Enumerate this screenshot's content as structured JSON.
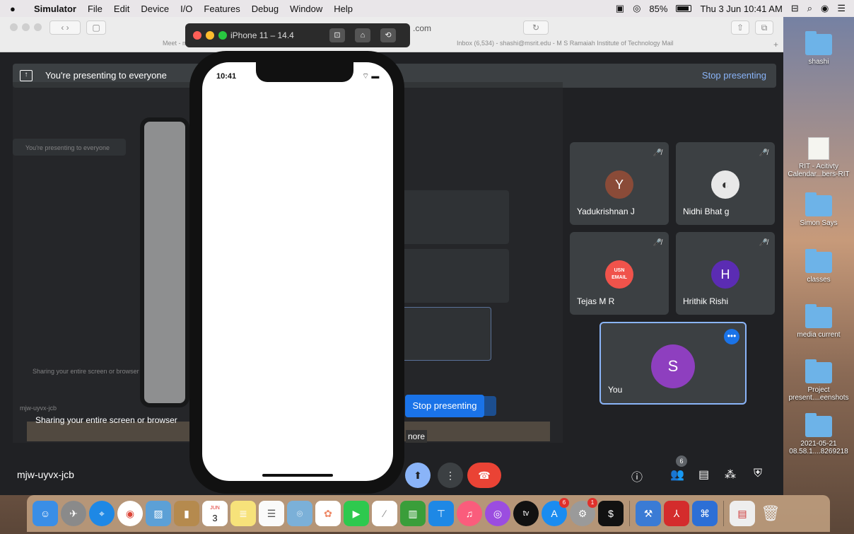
{
  "menubar": {
    "app": "Simulator",
    "items": [
      "File",
      "Edit",
      "Device",
      "I/O",
      "Features",
      "Debug",
      "Window",
      "Help"
    ],
    "battery": "85%",
    "datetime": "Thu 3 Jun 10:41 AM"
  },
  "browser": {
    "url_partial": ".com",
    "tab_left": "Meet - mjw-uyvx-jcb",
    "tab_right": "Inbox (6,534) - shashi@msrit.edu - M S Ramaiah Institute of Technology Mail"
  },
  "simulator": {
    "title": "iPhone 11 – 14.4",
    "phone_time": "10:41"
  },
  "meet": {
    "presenting_text": "You're presenting to everyone",
    "stop_presenting": "Stop presenting",
    "stop_presenting_button": "Stop presenting",
    "sharing_text": "Sharing your entire screen or browser",
    "more_text": "nore",
    "meeting_code": "mjw-uyvx-jcb",
    "participants_count": "6",
    "participants": [
      {
        "name": "Yadukrishnan J",
        "initial": "Y",
        "color": "#8a4b38"
      },
      {
        "name": "Nidhi Bhat g",
        "initial": "",
        "color": "#e8e8e8"
      },
      {
        "name": "Tejas M R",
        "initial": "USN EMAIL",
        "color": "#f0534b"
      },
      {
        "name": "Hrithik Rishi",
        "initial": "H",
        "color": "#5b2cb3"
      },
      {
        "name": "You",
        "initial": "S",
        "color": "#8e3fbf"
      }
    ]
  },
  "nested": {
    "sharing": "Sharing your entire screen or browser",
    "code": "mjw-uyvx-jcb",
    "presenting": "You're presenting to everyone"
  },
  "desktop": {
    "icons": [
      "shashi",
      "RIT - Acitivty Calendar...bers-RIT",
      "Simon Says",
      "classes",
      "media current",
      "Project present....eenshots",
      "2021-05-21 08.58.1....8269218"
    ]
  },
  "dock": {
    "calendar_day": "3",
    "calendar_month": "JUN",
    "tv_label": "tv",
    "appstore_badge": "6",
    "settings_badge": "1"
  }
}
